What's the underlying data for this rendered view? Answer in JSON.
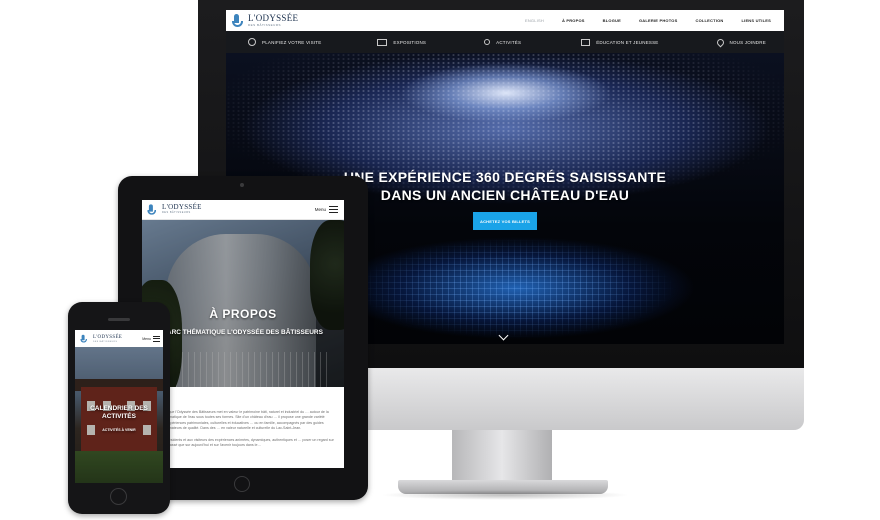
{
  "brand": {
    "name": "L'ODYSSÉE",
    "tagline": "DES BÂTISSEURS",
    "accent_color": "#1aa3e8",
    "logo_color": "#3d84bd"
  },
  "desktop": {
    "top_menu": [
      {
        "label": "ENGLISH",
        "muted": true
      },
      {
        "label": "À PROPOS"
      },
      {
        "label": "BLOGUE"
      },
      {
        "label": "GALERIE PHOTOS"
      },
      {
        "label": "COLLECTION"
      },
      {
        "label": "LIENS UTILES"
      }
    ],
    "nav": [
      {
        "label": "PLANIFIEZ VOTRE VISITE",
        "icon": "clock-icon"
      },
      {
        "label": "EXPOSITIONS",
        "icon": "picture-icon"
      },
      {
        "label": "ACTIVITÉS",
        "icon": "running-person-icon"
      },
      {
        "label": "ÉDUCATION ET JEUNESSE",
        "icon": "book-icon"
      },
      {
        "label": "NOUS JOINDRE",
        "icon": "map-pin-icon"
      }
    ],
    "hero": {
      "title_line1": "UNE EXPÉRIENCE 360 DEGRÉS SAISISSANTE",
      "title_line2": "DANS UN ANCIEN CHÂTEAU D'EAU",
      "cta": "ACHETEZ VOS BILLETS"
    }
  },
  "tablet": {
    "menu_label": "Menu",
    "hero_title": "À PROPOS",
    "hero_subtitle": "PARC THÉMATIQUE L'ODYSSÉE DES BÂTISSEURS",
    "paragraph1": "…ique l'Odyssée des Bâtisseurs met en valeur le patrimoine bâti, naturel et industriel du … autour de la thématique de l'eau sous toutes ses formes. Site d'un château d'eau … il propose une grande variété d'expériences patrimoniales, culturelles et éducatives … ou en famille, accompagnés par des guides animateurs de qualité. Dans des … en valeur naturelle et culturelle du Lac-Saint-Jean.",
    "paragraph2": "…résidents et aux visiteurs des expériences animées, dynamiques, authentiques et … poser un regard sur le passé que sur aujourd'hui et sur l'avenir toujours dans le…"
  },
  "phone": {
    "menu_label": "Menu",
    "hero_title": "CALENDRIER DES ACTIVITÉS",
    "hero_subtitle": "ACTIVITÉS À VENIR"
  }
}
